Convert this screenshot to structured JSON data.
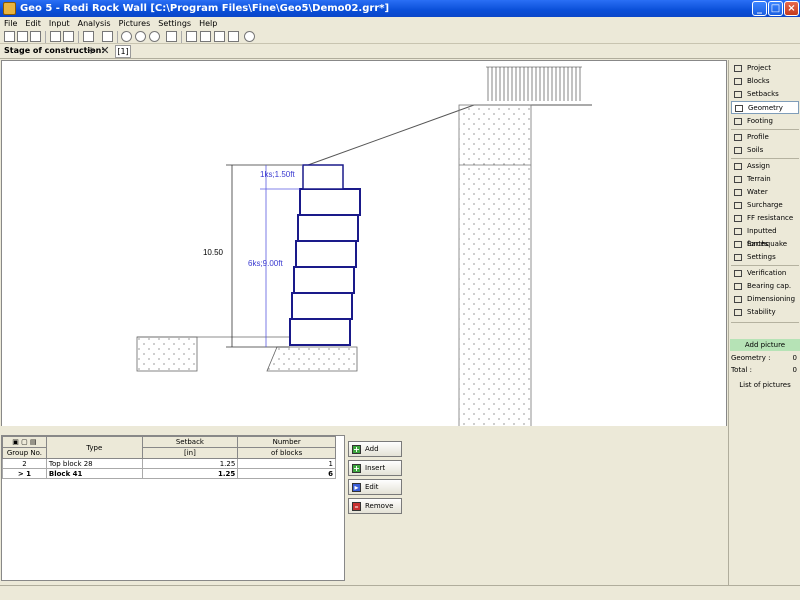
{
  "window": {
    "title": "Geo 5 - Redi Rock Wall [C:\\Program Files\\Fine\\Geo5\\Demo02.grr*]"
  },
  "menu": [
    "File",
    "Edit",
    "Input",
    "Analysis",
    "Pictures",
    "Settings",
    "Help"
  ],
  "stage": {
    "label": "Stage of construction:",
    "tab": "[1]"
  },
  "drawing": {
    "total_height": "10.50",
    "top_label": "1ks;1.50ft",
    "lower_label": "6ks;9.00ft"
  },
  "sidebar": {
    "items": [
      {
        "label": "Project",
        "icon": "project-icon"
      },
      {
        "label": "Blocks",
        "icon": "blocks-icon"
      },
      {
        "label": "Setbacks",
        "icon": "setbacks-icon"
      },
      {
        "label": "Geometry",
        "icon": "geometry-icon"
      },
      {
        "label": "Footing",
        "icon": "footing-icon"
      },
      {
        "label": "Profile",
        "icon": "profile-icon"
      },
      {
        "label": "Soils",
        "icon": "soils-icon"
      },
      {
        "label": "Assign",
        "icon": "assign-icon"
      },
      {
        "label": "Terrain",
        "icon": "terrain-icon"
      },
      {
        "label": "Water",
        "icon": "water-icon"
      },
      {
        "label": "Surcharge",
        "icon": "surcharge-icon"
      },
      {
        "label": "FF resistance",
        "icon": "ff-resistance-icon"
      },
      {
        "label": "Inputted forces",
        "icon": "inputted-forces-icon"
      },
      {
        "label": "Earthquake",
        "icon": "earthquake-icon"
      },
      {
        "label": "Settings",
        "icon": "settings-icon"
      },
      {
        "label": "Verification",
        "icon": "verification-icon"
      },
      {
        "label": "Bearing cap.",
        "icon": "bearing-cap-icon"
      },
      {
        "label": "Dimensioning",
        "icon": "dimensioning-icon"
      },
      {
        "label": "Stability",
        "icon": "stability-icon"
      }
    ],
    "active": "Geometry",
    "add_picture": "Add picture",
    "geometry_label": "Geometry :",
    "geometry_value": "0",
    "total_label": "Total :",
    "total_value": "0",
    "list_pictures": "List of pictures"
  },
  "table": {
    "headers": {
      "group": "Group No.",
      "type": "Type",
      "setback": "Setback",
      "setback_unit": "[in]",
      "number": "Number",
      "number_sub": "of blocks"
    },
    "rows": [
      {
        "group": "2",
        "type": "Top block 28",
        "setback": "1.25",
        "number": "1"
      },
      {
        "group": "> 1",
        "type": "Block 41",
        "setback": "1.25",
        "number": "6"
      }
    ]
  },
  "actions": {
    "add": "Add",
    "insert": "Insert",
    "edit": "Edit",
    "remove": "Remove"
  }
}
